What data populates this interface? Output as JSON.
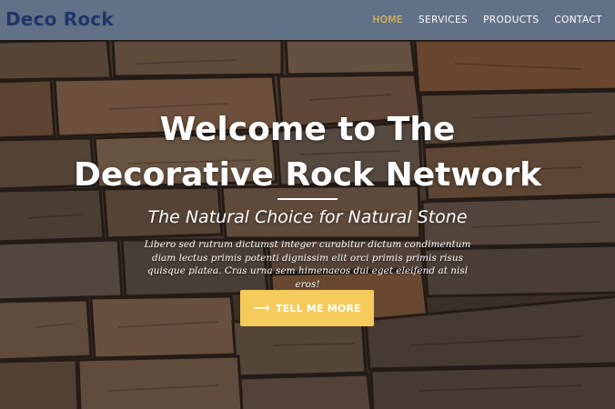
{
  "navbar": {
    "brand": "Deco Rock",
    "links": [
      {
        "label": "HOME",
        "active": true
      },
      {
        "label": "SERVICES",
        "active": false
      },
      {
        "label": "PRODUCTS",
        "active": false
      },
      {
        "label": "CONTACT",
        "active": false
      }
    ]
  },
  "hero": {
    "title_line1": "Welcome to The",
    "title_line2": "Decorative Rock Network",
    "subtitle": "The Natural Choice for Natural Stone",
    "lead": "Libero sed rutrum dictumst integer curabitur dictum condimentum diam lectus primis potenti dignissim elit orci primis primis risus quisque platea. Cras urna sem himenaeos dui eget eleifend at nisl eros!",
    "cta_label": "TELL ME MORE",
    "cta_icon": "arrow-right-icon"
  },
  "colors": {
    "navbar_bg": "#627187",
    "brand": "#1f3566",
    "nav_active": "#f2c94c",
    "cta_bg": "#f5cb5c"
  }
}
